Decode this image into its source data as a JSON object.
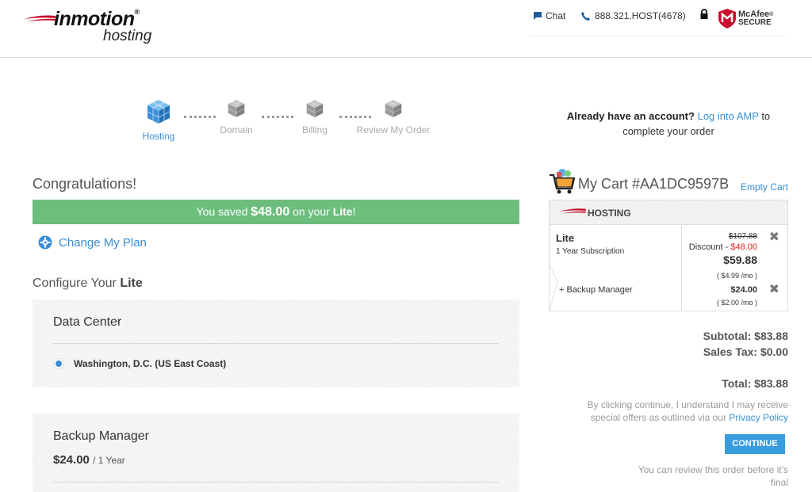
{
  "header": {
    "logo_brand": "inmotion",
    "logo_sub": "hosting",
    "logo_reg": "®",
    "chat_label": "Chat",
    "phone_label": "888.321.HOST(4678)",
    "mcafee_name": "McAfee",
    "mcafee_reg": "®",
    "mcafee_sub": "SECURE"
  },
  "steps": [
    {
      "label": "Hosting",
      "active": true
    },
    {
      "label": "Domain",
      "active": false
    },
    {
      "label": "Billing",
      "active": false
    },
    {
      "label": "Review My Order",
      "active": false
    }
  ],
  "account": {
    "question": "Already have an account?",
    "link": "Log into AMP",
    "suffix": "to",
    "line2": "complete your order"
  },
  "main": {
    "congrats": "Congratulations!",
    "savings_prefix": "You saved",
    "savings_amount": "$48.00",
    "savings_mid": "on your",
    "savings_plan": "Lite",
    "savings_suffix": "!",
    "change_plan": "Change My Plan",
    "configure_prefix": "Configure Your",
    "configure_plan": "Lite",
    "data_center_title": "Data Center",
    "data_center_option": "Washington, D.C. (US East Coast)",
    "backup_title": "Backup Manager",
    "backup_price": "$24.00",
    "backup_term": "/ 1 Year"
  },
  "cart": {
    "title": "My Cart #AA1DC9597B",
    "empty": "Empty Cart",
    "section": "HOSTING",
    "item_name": "Lite",
    "item_term": "1 Year Subscription",
    "old_price": "$107.88",
    "discount_label": "Discount -",
    "discount_value": "$48.00",
    "new_price": "$59.88",
    "per_month": "( $4.99 /mo )",
    "addon_name": "+ Backup Manager",
    "addon_price": "$24.00",
    "addon_per_month": "( $2.00 /mo )",
    "subtotal": "Subtotal: $83.88",
    "tax": "Sales Tax: $0.00",
    "total": "Total: $83.88"
  },
  "legal": {
    "text": "By clicking continue, I understand I may receive special offers as outlined via our",
    "link": "Privacy Policy"
  },
  "continue_label": "CONTINUE",
  "review_note": "You can review this order before it's final",
  "colors": {
    "accent": "#3a8fd6",
    "savings_green": "#6dbe7d",
    "discount_red": "#e2231a",
    "continue_blue": "#3a9ce0"
  }
}
